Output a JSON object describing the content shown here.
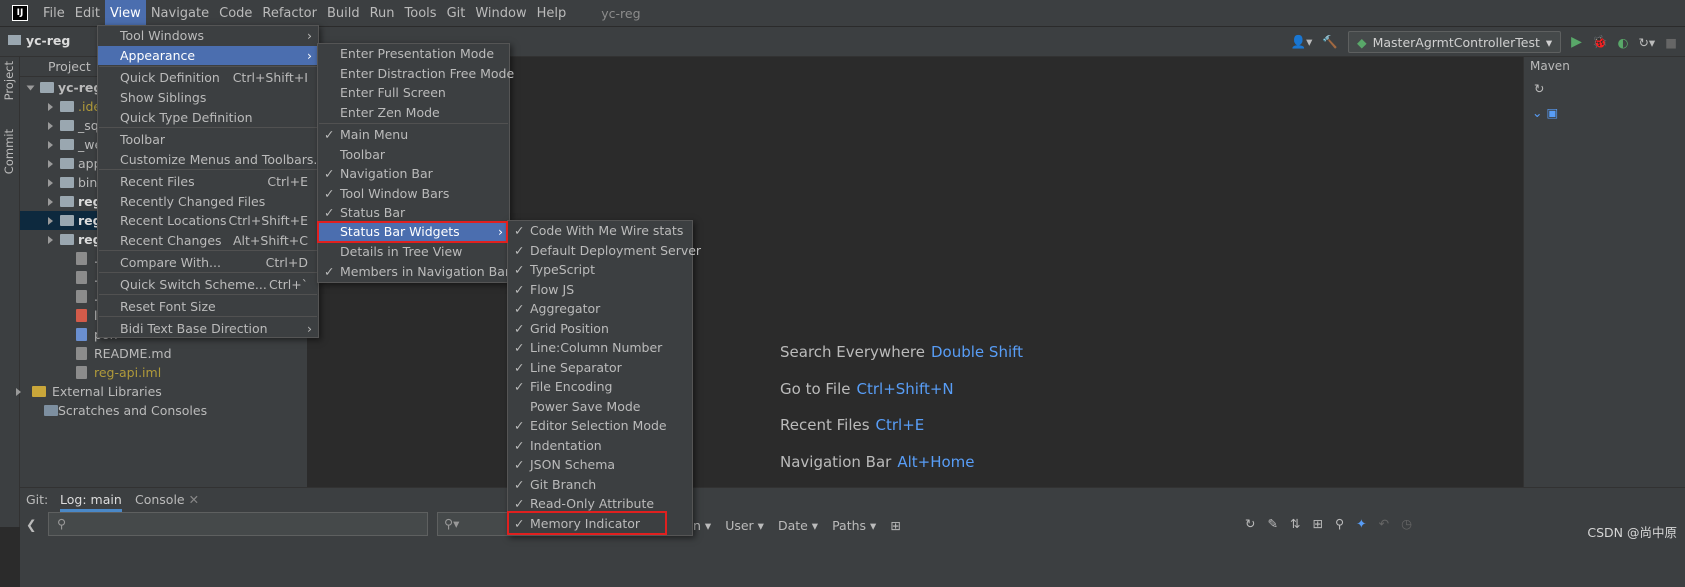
{
  "menubar": {
    "items": [
      "File",
      "Edit",
      "View",
      "Navigate",
      "Code",
      "Refactor",
      "Build",
      "Run",
      "Tools",
      "Git",
      "Window",
      "Help"
    ],
    "title": "yc-reg"
  },
  "nav": {
    "project": "yc-reg",
    "run_config": "MasterAgrmtControllerTest"
  },
  "left_tabs": {
    "project": "Project",
    "commit": "Commit"
  },
  "project": {
    "header": "Project",
    "root": "yc-reg",
    "nodes": [
      ".ide",
      "_sql",
      "_we",
      "app",
      "bin",
      "reg",
      "reg",
      "reg",
      ".gita",
      ".giti",
      ".gitl",
      "lom",
      "pon",
      "README.md",
      "reg-api.iml",
      "External Libraries",
      "Scratches and Consoles"
    ]
  },
  "editor_hints": [
    {
      "label": "Search Everywhere",
      "key": "Double Shift"
    },
    {
      "label": "Go to File",
      "key": "Ctrl+Shift+N"
    },
    {
      "label": "Recent Files",
      "key": "Ctrl+E"
    },
    {
      "label": "Navigation Bar",
      "key": "Alt+Home"
    }
  ],
  "right_panel": {
    "title": "Maven"
  },
  "bottom": {
    "git": "Git:",
    "log": "Log: main",
    "console": "Console",
    "filters": {
      "n": "n",
      "user": "User",
      "date": "Date",
      "paths": "Paths"
    }
  },
  "view_menu": [
    {
      "label": "Tool Windows",
      "sub": true
    },
    {
      "label": "Appearance",
      "sub": true,
      "hl": true
    },
    {
      "label": "Quick Definition",
      "sc": "Ctrl+Shift+I"
    },
    {
      "label": "Show Siblings"
    },
    {
      "label": "Quick Type Definition"
    },
    {
      "label": "Toolbar"
    },
    {
      "label": "Customize Menus and Toolbars..."
    },
    {
      "label": "Recent Files",
      "sc": "Ctrl+E"
    },
    {
      "label": "Recently Changed Files"
    },
    {
      "label": "Recent Locations",
      "sc": "Ctrl+Shift+E"
    },
    {
      "label": "Recent Changes",
      "sc": "Alt+Shift+C"
    },
    {
      "label": "Compare With...",
      "sc": "Ctrl+D"
    },
    {
      "label": "Quick Switch Scheme...",
      "sc": "Ctrl+`"
    },
    {
      "label": "Reset Font Size"
    },
    {
      "label": "Bidi Text Base Direction",
      "sub": true
    }
  ],
  "appearance_menu": [
    {
      "label": "Enter Presentation Mode"
    },
    {
      "label": "Enter Distraction Free Mode"
    },
    {
      "label": "Enter Full Screen"
    },
    {
      "label": "Enter Zen Mode"
    },
    {
      "label": "Main Menu",
      "chk": true
    },
    {
      "label": "Toolbar"
    },
    {
      "label": "Navigation Bar",
      "chk": true
    },
    {
      "label": "Tool Window Bars",
      "chk": true
    },
    {
      "label": "Status Bar",
      "chk": true
    },
    {
      "label": "Status Bar Widgets",
      "sub": true,
      "hl": true
    },
    {
      "label": "Details in Tree View"
    },
    {
      "label": "Members in Navigation Bar",
      "chk": true
    }
  ],
  "widgets_menu": [
    {
      "label": "Code With Me Wire stats",
      "chk": true
    },
    {
      "label": "Default Deployment Server",
      "chk": true
    },
    {
      "label": "TypeScript",
      "chk": true
    },
    {
      "label": "Flow JS",
      "chk": true
    },
    {
      "label": "Aggregator",
      "chk": true
    },
    {
      "label": "Grid Position",
      "chk": true
    },
    {
      "label": "Line:Column Number",
      "chk": true
    },
    {
      "label": "Line Separator",
      "chk": true
    },
    {
      "label": "File Encoding",
      "chk": true
    },
    {
      "label": "Power Save Mode",
      "chk": false
    },
    {
      "label": "Editor Selection Mode",
      "chk": true
    },
    {
      "label": "Indentation",
      "chk": true
    },
    {
      "label": "JSON Schema",
      "chk": true
    },
    {
      "label": "Git Branch",
      "chk": true
    },
    {
      "label": "Read-Only Attribute",
      "chk": true
    },
    {
      "label": "Memory Indicator",
      "chk": true
    }
  ],
  "watermark": "CSDN @尚中原"
}
